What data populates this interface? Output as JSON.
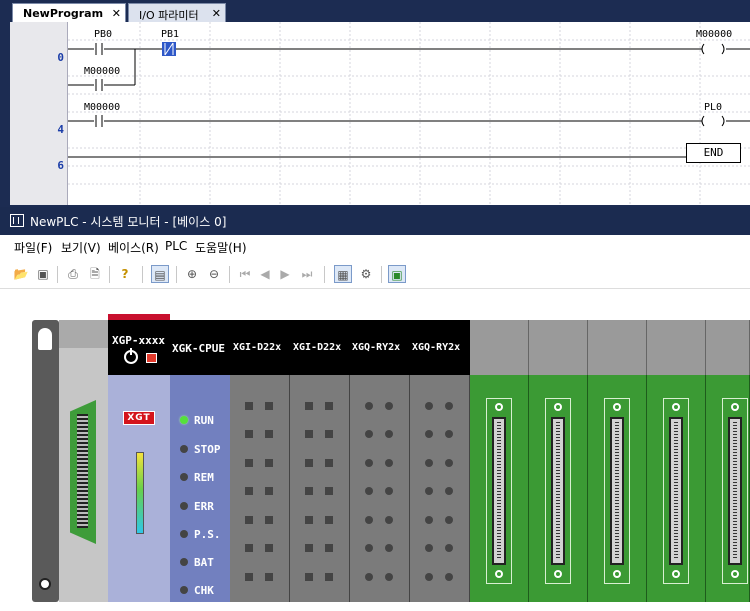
{
  "editor": {
    "tabs": [
      {
        "label": "NewProgram",
        "close": "✕"
      },
      {
        "label": "I/O 파라미터",
        "close": "✕"
      }
    ],
    "rung_numbers": [
      "0",
      "4",
      "6"
    ],
    "contacts": {
      "pb0": "PB0",
      "pb1": "PB1",
      "m_seal": "M00000",
      "m_rung4": "M00000"
    },
    "coils": {
      "m00000": "M00000",
      "pl0": "PL0",
      "coil_symbol": "( )"
    },
    "end_label": "END"
  },
  "monitor": {
    "title": "NewPLC - 시스템 모니터 - [베이스 0]",
    "menu": [
      "파일(F)",
      "보기(V)",
      "베이스(R)",
      "PLC",
      "도움말(H)"
    ],
    "toolbar_icons": [
      "open-icon",
      "save-icon",
      "print-icon",
      "print-preview-icon",
      "help-icon",
      "monitor-icon",
      "zoom-in-icon",
      "zoom-out-icon",
      "first-icon",
      "prev-icon",
      "next-icon",
      "last-icon",
      "base-icon",
      "module-info-icon",
      "system-icon"
    ]
  },
  "rack": {
    "cpu_title": "XGP-xxxx",
    "logo": "XGT",
    "status_title": "XGK-CPUE",
    "status_items": [
      "RUN",
      "STOP",
      "REM",
      "ERR",
      "P.S.",
      "BAT",
      "CHK"
    ],
    "modules": [
      "XGI-D22x",
      "XGI-D22x",
      "XGQ-RY2x",
      "XGQ-RY2x"
    ]
  },
  "colors": {
    "window_bg": "#1c2c52",
    "cpu": "#aab1d9",
    "status": "#7280bf",
    "module": "#7b7b7b",
    "empty_slot": "#3b9a34",
    "run_led": "#55e13b",
    "stop_led": "#e23a2c"
  }
}
